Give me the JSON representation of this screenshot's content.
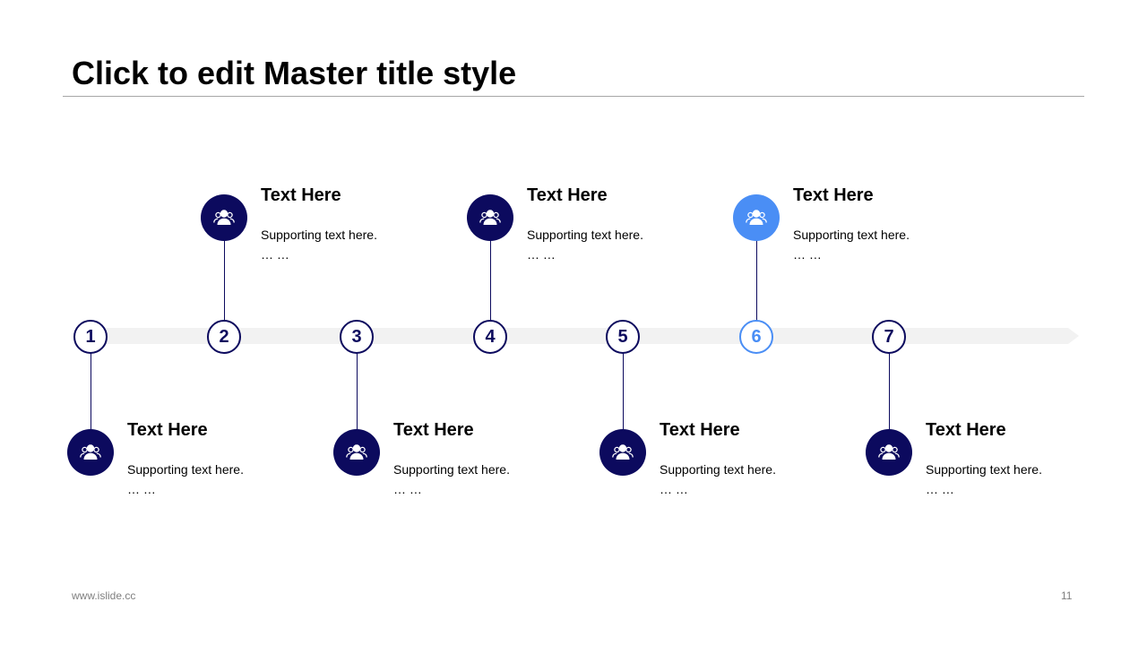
{
  "title": "Click to edit Master title style",
  "colors": {
    "primary": "#0c0a5e",
    "highlight": "#4a8ef5",
    "track": "#f2f2f2"
  },
  "steps": [
    {
      "number": "1",
      "title": "Text Here",
      "text": "Supporting text here.",
      "ellipsis": "… …",
      "position": "below",
      "highlight": false,
      "icon": "users-icon"
    },
    {
      "number": "2",
      "title": "Text Here",
      "text": "Supporting text here.",
      "ellipsis": "… …",
      "position": "above",
      "highlight": false,
      "icon": "users-icon"
    },
    {
      "number": "3",
      "title": "Text Here",
      "text": "Supporting text here.",
      "ellipsis": "… …",
      "position": "below",
      "highlight": false,
      "icon": "users-icon"
    },
    {
      "number": "4",
      "title": "Text Here",
      "text": "Supporting text here.",
      "ellipsis": "… …",
      "position": "above",
      "highlight": false,
      "icon": "users-icon"
    },
    {
      "number": "5",
      "title": "Text Here",
      "text": "Supporting text here.",
      "ellipsis": "… …",
      "position": "below",
      "highlight": false,
      "icon": "users-icon"
    },
    {
      "number": "6",
      "title": "Text Here",
      "text": "Supporting text here.",
      "ellipsis": "… …",
      "position": "above",
      "highlight": true,
      "icon": "users-icon"
    },
    {
      "number": "7",
      "title": "Text Here",
      "text": "Supporting text here.",
      "ellipsis": "… …",
      "position": "below",
      "highlight": false,
      "icon": "users-icon"
    }
  ],
  "footer": {
    "url": "www.islide.cc",
    "page": "11"
  }
}
